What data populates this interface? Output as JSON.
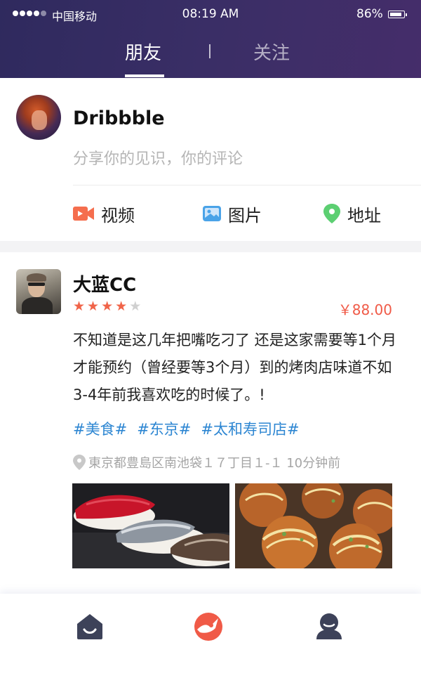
{
  "status_bar": {
    "carrier": "中国移动",
    "time": "08:19 AM",
    "battery": "86%",
    "signal_bars": 4
  },
  "tabs": [
    {
      "label": "朋友",
      "active": true
    },
    {
      "label": "关注",
      "active": false
    }
  ],
  "composer": {
    "user_name": "Dribbble",
    "placeholder": "分享你的见识，你的评论",
    "actions": [
      {
        "label": "视频",
        "icon": "video-icon",
        "color": "#f56e4e"
      },
      {
        "label": "图片",
        "icon": "image-icon",
        "color": "#4aa3e8"
      },
      {
        "label": "地址",
        "icon": "location-pin-icon",
        "color": "#5ccf72"
      }
    ]
  },
  "post": {
    "author": "大蓝CC",
    "rating": 4,
    "rating_max": 5,
    "price": "￥88.00",
    "text": "不知道是这几年把嘴吃刁了 还是这家需要等1个月才能预约（曾经要等3个月）到的烤肉店味道不如3-4年前我喜欢吃的时候了。!",
    "tags": [
      "#美食#",
      "#东京#",
      "#太和寿司店#"
    ],
    "location": "東京都豊島区南池袋１７丁目１-１ 10分钟前",
    "photos": [
      {
        "subject": "sushi-photo"
      },
      {
        "subject": "takoyaki-photo"
      }
    ]
  },
  "bottom_nav": {
    "items": [
      {
        "icon": "home-icon"
      },
      {
        "icon": "discover-icon"
      },
      {
        "icon": "profile-icon"
      }
    ]
  },
  "colors": {
    "header_gradient_start": "#2f2a5e",
    "header_gradient_end": "#452d6a",
    "accent_red": "#f05a47",
    "tag_blue": "#2d86d2",
    "star_active": "#f06449",
    "star_inactive": "#d0d0d0",
    "nav_icon_dark": "#3d4259"
  }
}
